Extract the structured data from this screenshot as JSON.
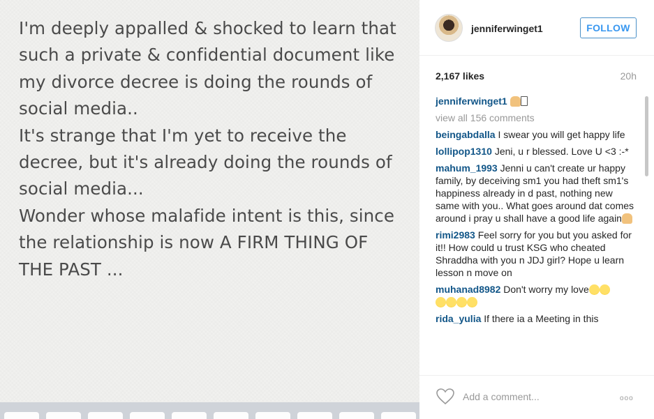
{
  "note": {
    "lines": [
      "I'm deeply appalled & shocked to learn that",
      "such a private & confidential document like",
      "my divorce decree is doing the rounds of",
      "social media..",
      "It's strange that I'm yet to receive the",
      "decree, but it's already doing the rounds of",
      "social media...",
      "Wonder whose malafide intent is this, since",
      "the relationship is now A FIRM THING OF",
      "THE PAST ..."
    ]
  },
  "header": {
    "username": "jenniferwinget1",
    "follow_label": "FOLLOW"
  },
  "stats": {
    "likes": "2,167 likes",
    "time_ago": "20h"
  },
  "caption": {
    "user": "jenniferwinget1"
  },
  "view_all": "view all 156 comments",
  "comments": [
    {
      "user": "beingabdalla",
      "text": "I swear you will get happy life"
    },
    {
      "user": "lollipop1310",
      "text": "Jeni, u r blessed. Love U <3 :-*"
    },
    {
      "user": "mahum_1993",
      "text": "Jenni u can't create ur happy family, by deceiving sm1 you had theft sm1's happiness already in d past, nothing new same with you.. What goes around dat comes around i pray u shall have a good life again"
    },
    {
      "user": "rimi2983",
      "text": "Feel sorry for you but you asked for it!! How could u trust KSG who cheated Shraddha with you n JDJ girl? Hope u learn lesson n move on"
    },
    {
      "user": "muhanad8982",
      "text": "Don't worry my love"
    },
    {
      "user": "rida_yulia",
      "text": "If there ia a Meeting in this"
    }
  ],
  "footer": {
    "add_comment_placeholder": "Add a comment...",
    "more_label": "ooo"
  },
  "colors": {
    "accent": "#3897f0",
    "username": "#125688"
  },
  "icons": [
    "heart-icon",
    "more-options-icon"
  ]
}
